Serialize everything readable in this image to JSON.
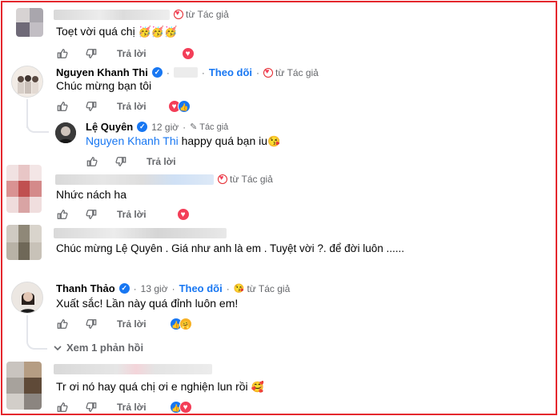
{
  "comments": [
    {
      "author_badge": "từ Tác giả",
      "text": "Toẹt vời quá chị",
      "text_emoji": "🥳🥳🥳",
      "reply_label": "Trả lời"
    },
    {
      "name": "Nguyen Khanh Thi",
      "follow_label": "Theo dõi",
      "author_badge": "từ Tác giả",
      "text": "Chúc mừng bạn tôi",
      "reply_label": "Trả lời"
    },
    {
      "name": "Lệ Quyên",
      "time": "12 giờ",
      "author_label": "Tác giả",
      "mention": "Nguyen Khanh Thi",
      "text": "happy quá bạn iu",
      "text_emoji": "😘",
      "reply_label": "Trả lời"
    },
    {
      "author_badge": "từ Tác giả",
      "text": "Nhức nách ha",
      "reply_label": "Trả lời"
    },
    {
      "text": "Chúc mừng Lệ Quyên . Giá như anh là em . Tuyệt vời ?. để đời luôn ......"
    },
    {
      "name": "Thanh Thảo",
      "time": "13 giờ",
      "follow_label": "Theo dõi",
      "author_badge": "từ Tác giả",
      "text": "Xuất sắc! Lần này quá đỉnh luôn em!",
      "reply_label": "Trả lời",
      "see_replies": "Xem 1 phản hồi"
    },
    {
      "text": "Tr ơi nó hay quá chị ơi e nghiện lun rồi",
      "text_emoji": "🥰",
      "reply_label": "Trả lời"
    }
  ],
  "colors": {
    "link_blue": "#1877f2",
    "border_red": "#e4262c",
    "love_red": "#f33e58",
    "muted_gray": "#65676b"
  },
  "icons": [
    "like-outline-icon",
    "dislike-outline-icon",
    "verified-badge-icon",
    "love-reaction-icon",
    "like-reaction-icon",
    "care-reaction-icon",
    "pen-icon",
    "chevron-down-icon"
  ]
}
